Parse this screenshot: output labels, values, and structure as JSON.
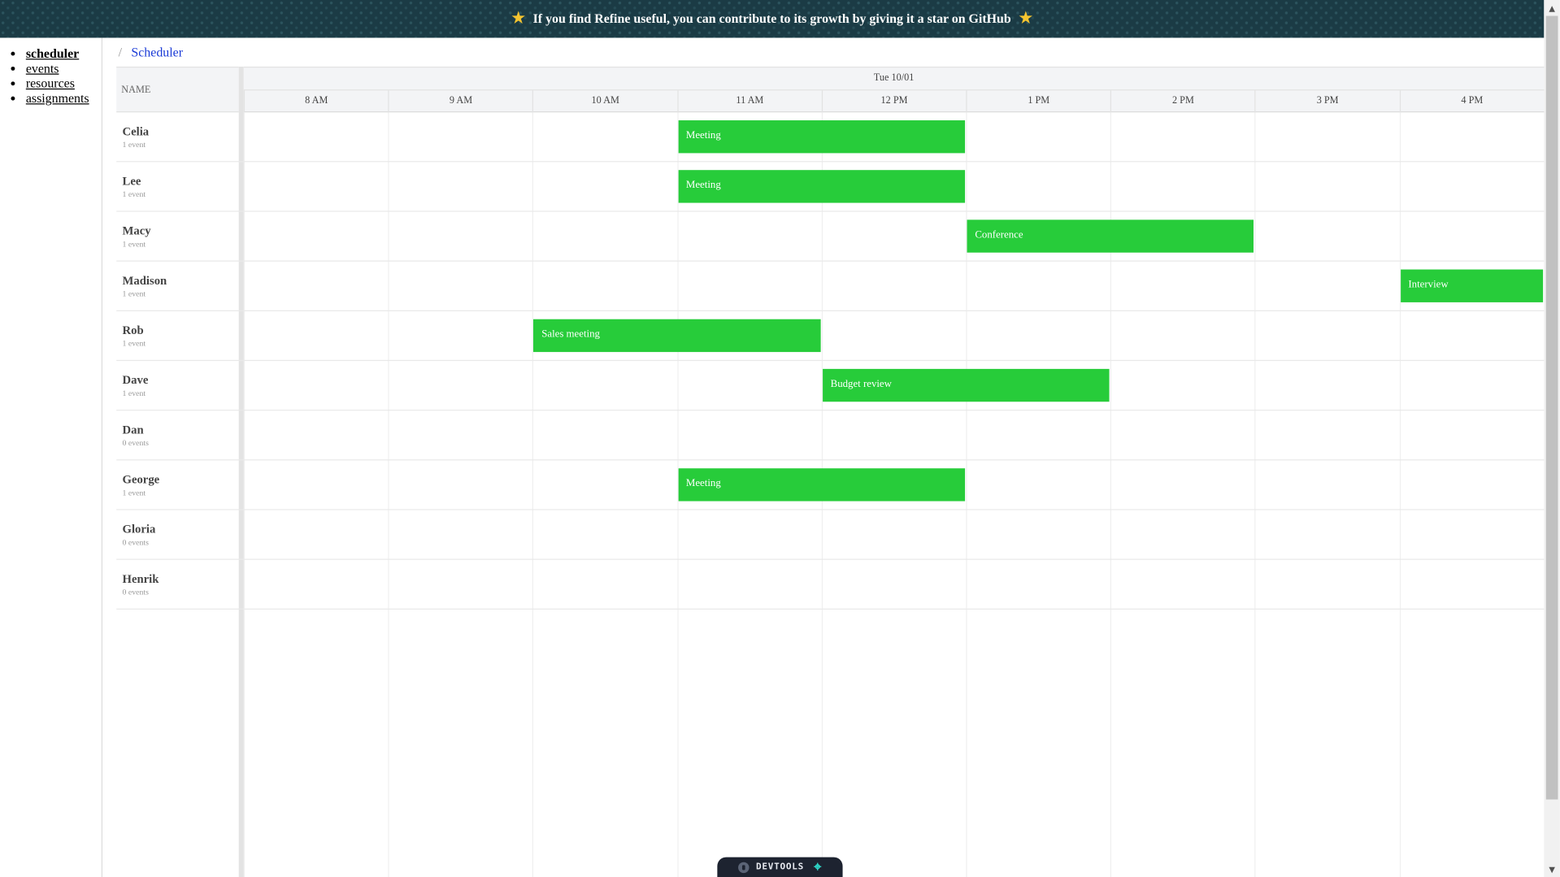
{
  "banner": {
    "text": "If you find Refine useful, you can contribute to its growth by giving it a star on GitHub",
    "star_icon": "★"
  },
  "nav": {
    "items": [
      {
        "label": "scheduler",
        "active": true
      },
      {
        "label": "events",
        "active": false
      },
      {
        "label": "resources",
        "active": false
      },
      {
        "label": "assignments",
        "active": false
      }
    ]
  },
  "breadcrumb": {
    "separator": "/",
    "current": "Scheduler"
  },
  "scheduler": {
    "name_header": "NAME",
    "date": "Tue 10/01",
    "hours": [
      "8 AM",
      "9 AM",
      "10 AM",
      "11 AM",
      "12 PM",
      "1 PM",
      "2 PM",
      "3 PM",
      "4 PM"
    ],
    "resources": [
      {
        "name": "Celia",
        "count": "1 event"
      },
      {
        "name": "Lee",
        "count": "1 event"
      },
      {
        "name": "Macy",
        "count": "1 event"
      },
      {
        "name": "Madison",
        "count": "1 event"
      },
      {
        "name": "Rob",
        "count": "1 event"
      },
      {
        "name": "Dave",
        "count": "1 event"
      },
      {
        "name": "Dan",
        "count": "0 events"
      },
      {
        "name": "George",
        "count": "1 event"
      },
      {
        "name": "Gloria",
        "count": "0 events"
      },
      {
        "name": "Henrik",
        "count": "0 events"
      }
    ],
    "events": [
      {
        "title": "Meeting",
        "resource": 0,
        "start": 11,
        "end": 13
      },
      {
        "title": "Meeting",
        "resource": 1,
        "start": 11,
        "end": 13
      },
      {
        "title": "Conference",
        "resource": 2,
        "start": 13,
        "end": 15
      },
      {
        "title": "Interview",
        "resource": 3,
        "start": 16,
        "end": 17
      },
      {
        "title": "Sales meeting",
        "resource": 4,
        "start": 10,
        "end": 12
      },
      {
        "title": "Budget review",
        "resource": 5,
        "start": 12,
        "end": 14
      },
      {
        "title": "Meeting",
        "resource": 7,
        "start": 11,
        "end": 13
      }
    ],
    "event_color": "#27cc3a"
  },
  "devtools": {
    "label": "DEVTOOLS"
  },
  "colors": {
    "banner_bg": "#1b3b45",
    "link": "#1a3ad6",
    "star": "#f4c430"
  }
}
